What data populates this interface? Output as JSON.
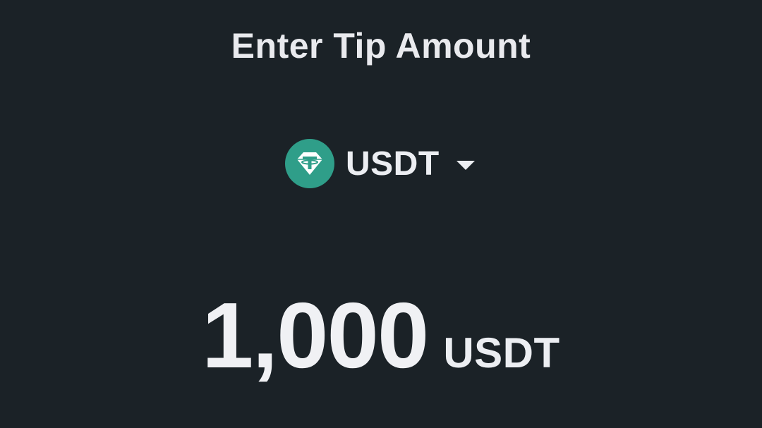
{
  "header": {
    "title": "Enter Tip Amount"
  },
  "currency_selector": {
    "icon": "tether-icon",
    "label": "USDT",
    "accent_color": "#2f9e89"
  },
  "amount": {
    "value": "1,000",
    "unit": "USDT"
  }
}
